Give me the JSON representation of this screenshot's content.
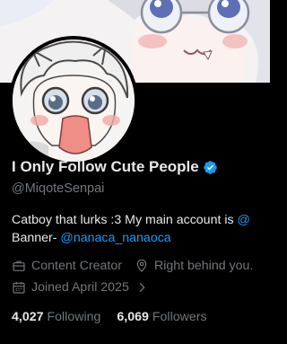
{
  "profile": {
    "display_name": "I Only Follow Cute People",
    "handle": "@MiqoteSenpai",
    "bio_line1": "Catboy that lurks :3  My main account is ",
    "bio_line1_link": "@",
    "bio_line2_prefix": "Banner- ",
    "bio_line2_link": "@nanaca_nanaoca",
    "category": "Content Creator",
    "location": "Right behind you.",
    "joined": "Joined April 2025",
    "following_count": "4,027",
    "following_label": "Following",
    "followers_count": "6,069",
    "followers_label": "Followers"
  },
  "colors": {
    "background": "#000000",
    "text": "#e7e9ea",
    "muted": "#71767b",
    "link": "#1d9bf0",
    "verified": "#1d9bf0"
  },
  "icons": {
    "verified": "verified-badge-icon",
    "category": "briefcase-icon",
    "location": "location-pin-icon",
    "joined": "calendar-icon",
    "joined_more": "chevron-right-icon"
  }
}
